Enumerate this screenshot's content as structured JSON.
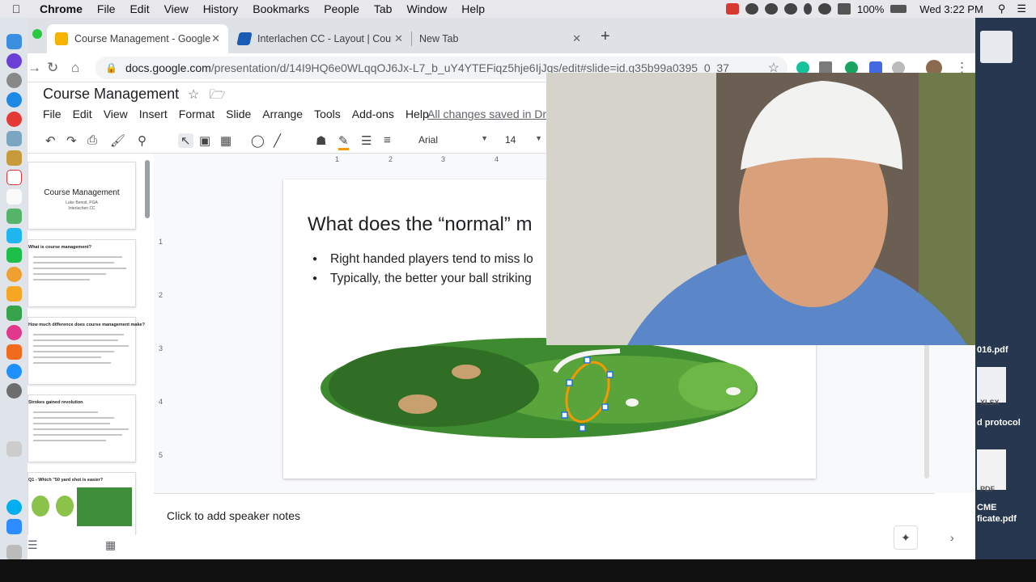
{
  "menubar": {
    "app_name": "Chrome",
    "items": [
      "File",
      "Edit",
      "View",
      "History",
      "Bookmarks",
      "People",
      "Tab",
      "Window",
      "Help"
    ],
    "battery": "100%",
    "clock": "Wed 3:22 PM"
  },
  "browser": {
    "tabs": [
      {
        "title": "Course Management - Google",
        "favicon_color": "#f4b400"
      },
      {
        "title": "Interlachen CC - Layout | Cou",
        "favicon_color": "#1a5bb5"
      },
      {
        "title": "New Tab",
        "favicon_color": ""
      }
    ],
    "url_host": "docs.google.com",
    "url_path": "/presentation/d/14I9HQ6e0WLqqOJ6Jx-L7_b_uY4YTEFiqz5hje6IjJqs/edit#slide=id.g35b99a0395_0_37"
  },
  "slides_app": {
    "doc_title": "Course Management",
    "menu": [
      "File",
      "Edit",
      "View",
      "Insert",
      "Format",
      "Slide",
      "Arrange",
      "Tools",
      "Add-ons",
      "Help"
    ],
    "saved_status": "All changes saved in Drive",
    "font_name": "Arial",
    "font_size": "14",
    "ruler_h": [
      "1",
      "2",
      "3",
      "4"
    ],
    "ruler_v": [
      "1",
      "2",
      "3",
      "4",
      "5"
    ],
    "speaker_notes_placeholder": "Click to add speaker notes"
  },
  "filmstrip": [
    {
      "title": "Course Management",
      "subtitle1": "Luke Benoit, PGA",
      "subtitle2": "Interlachen CC"
    },
    {
      "title": "What is course management?"
    },
    {
      "title": "How much difference does course management make?"
    },
    {
      "title": "Strokes gained revolution"
    },
    {
      "title": "Q1 - Which \"50 yard shot is easier?"
    }
  ],
  "slide": {
    "title": "What does the “normal” m",
    "bullets": [
      "Right handed players tend to miss lo",
      "Typically, the better your ball striking"
    ]
  },
  "desktop": {
    "labels": [
      "016.pdf",
      "XLSX",
      "d protocol",
      "PDF",
      "CME",
      "ficate.pdf"
    ]
  }
}
